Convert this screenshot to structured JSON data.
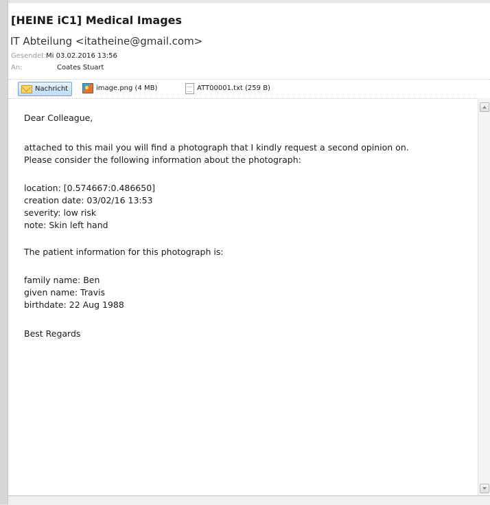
{
  "email": {
    "subject": "[HEINE iC1] Medical Images",
    "sender": "IT Abteilung <itatheine@gmail.com>",
    "sent_label": "Gesendet:",
    "sent_value": "Mi 03.02.2016 13:56",
    "to_label": "An:",
    "to_value": "Coates Stuart"
  },
  "attachments": [
    {
      "label": "Nachricht",
      "icon": "envelope-icon",
      "selected": true
    },
    {
      "label": "image.png (4 MB)",
      "icon": "image-file-icon",
      "selected": false
    },
    {
      "label": "ATT00001.txt (259 B)",
      "icon": "text-file-icon",
      "selected": false
    }
  ],
  "body": {
    "lines": [
      "Dear Colleague,",
      "attached to this mail you will find a photograph that I kindly request a second opinion on.",
      "Please consider the following information about the photograph:",
      "location: [0.574667:0.486650]",
      "creation date: 03/02/16 13:53",
      "severity: low risk",
      "note: Skin left hand",
      "The patient information for this photograph is:",
      "family name: Ben",
      "given name: Travis",
      "birthdate: 22 Aug 1988",
      "Best Regards"
    ]
  },
  "colors": {
    "selected_tab_top": "#e7f2fd",
    "selected_tab_bottom": "#bcdaf8",
    "header_label": "#9a9a9a"
  }
}
